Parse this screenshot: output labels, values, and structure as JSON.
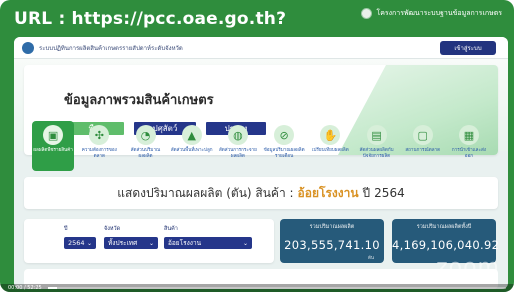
{
  "banner": {
    "url_text": "URL : https://pcc.oae.go.th?",
    "org_text": "โครงการพัฒนาระบบฐานข้อมูลการเกษตร"
  },
  "topbar": {
    "system_name": "ระบบปฏิทินการผลิตสินค้าเกษตรรายสัปดาห์ระดับจังหวัด",
    "login_label": "เข้าสู่ระบบ"
  },
  "hero": {
    "title": "ข้อมูลภาพรวมสินค้าเกษตร",
    "tabs": [
      {
        "label": "พืช",
        "active": true
      },
      {
        "label": "ปศุสัตว์",
        "active": false
      },
      {
        "label": "ประมง",
        "active": false
      }
    ]
  },
  "categories": [
    {
      "label": "ผลผลิตพืชรายสินค้า",
      "icon": "box-icon",
      "active": true
    },
    {
      "label": "ความต้องการของตลาด",
      "icon": "fork-knife-icon",
      "active": false
    },
    {
      "label": "สัดส่วนปริมาณผลผลิต",
      "icon": "pie-chart-icon",
      "active": false
    },
    {
      "label": "สัดส่วนพื้นที่เพาะปลูก",
      "icon": "field-icon",
      "active": false
    },
    {
      "label": "สัดส่วนการกระจายผลผลิต",
      "icon": "globe-icon",
      "active": false
    },
    {
      "label": "ข้อมูลปริมาณผลผลิตรายเดือน",
      "icon": "compass-icon",
      "active": false
    },
    {
      "label": "เปรียบเทียบผลผลิต",
      "icon": "hand-icon",
      "active": false
    },
    {
      "label": "สัดส่วนผลผลิตกับปัจจัยการผลิต",
      "icon": "document-icon",
      "active": false
    },
    {
      "label": "สถานการณ์ตลาด",
      "icon": "chat-icon",
      "active": false
    },
    {
      "label": "การนำเข้าและส่งออก",
      "icon": "report-icon",
      "active": false
    }
  ],
  "summary": {
    "prefix": "แสดงปริมาณผลผลิต (ตัน)  สินค้า :",
    "product": "อ้อยโรงงาน",
    "year_prefix": "ปี",
    "year": "2564"
  },
  "filters": {
    "year_label": "ปี",
    "year_value": "2564",
    "province_label": "จังหวัด",
    "province_value": "ทั้งประเทศ",
    "product_label": "สินค้า",
    "product_value": "อ้อยโรงงาน"
  },
  "stats": [
    {
      "caption": "รวมปริมาณผลผลิต",
      "value": "203,555,741.10",
      "unit": "ตัน"
    },
    {
      "caption": "รวมปริมาณผลผลิตทั้งปี",
      "value": "4,169,106,040.92",
      "unit": ""
    }
  ],
  "watermark": "zoom",
  "video": {
    "time": "00:00 / 52:25",
    "progress": 0.02
  },
  "colors": {
    "frame_green": "#2f8d3d",
    "nav_blue": "#25368a",
    "accent_orange": "#d99224",
    "stat_teal": "#265a7a"
  }
}
